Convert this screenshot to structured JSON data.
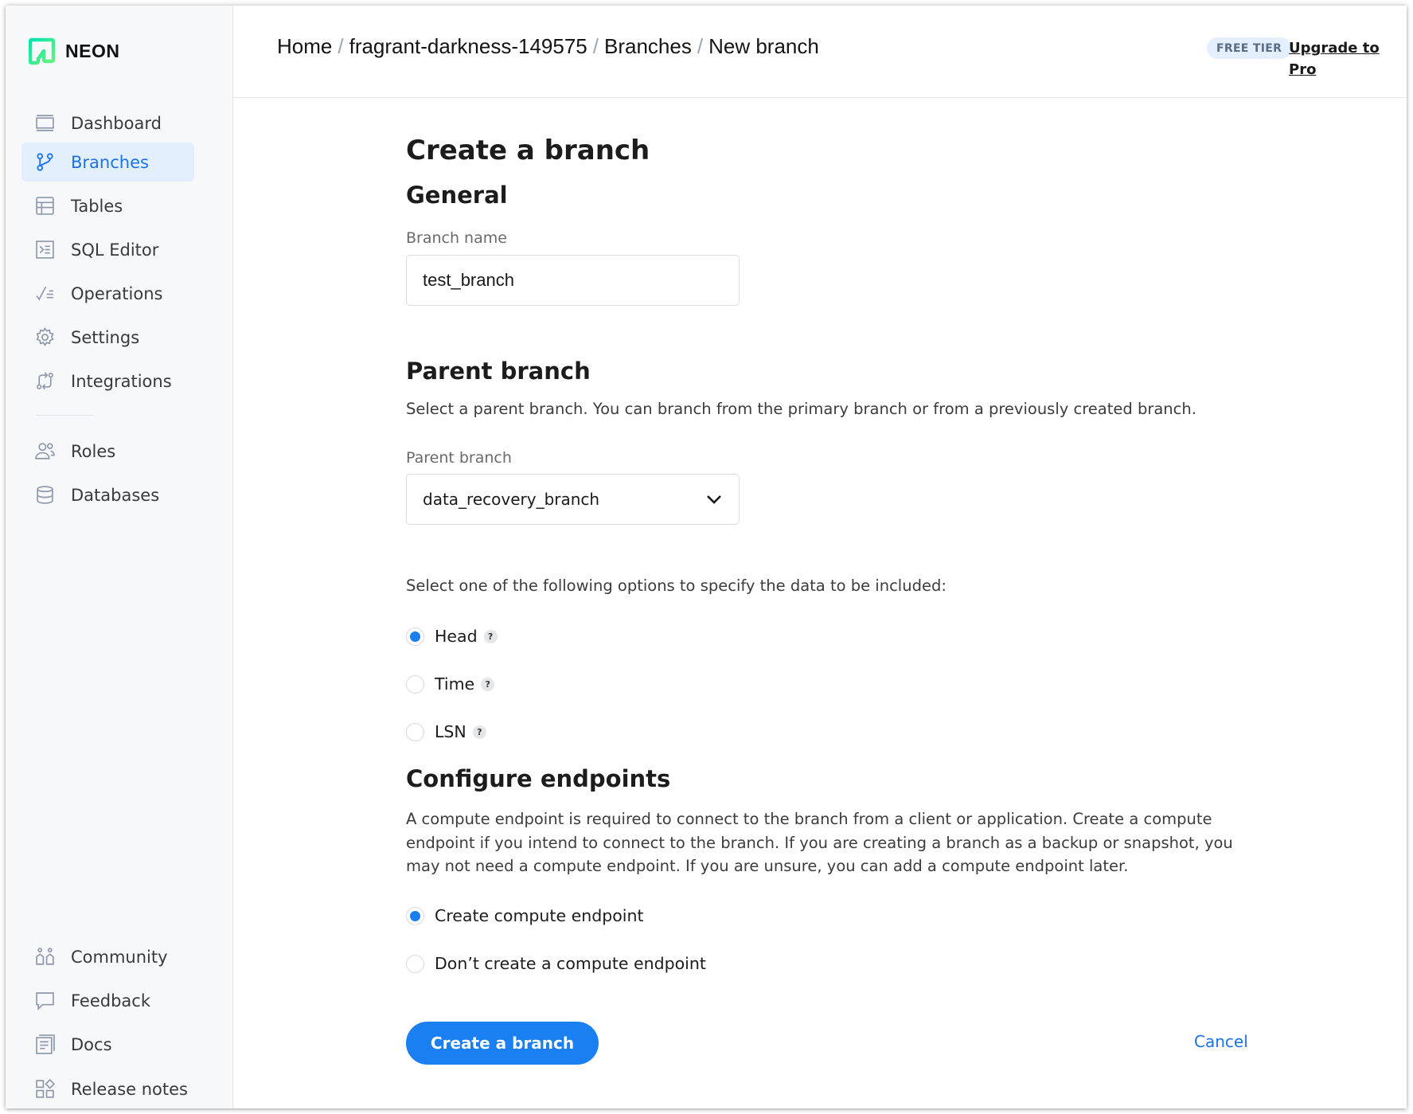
{
  "app": {
    "brand": "NEON",
    "brand_color": "#1a7ff0",
    "logo_colors": [
      "#00e599",
      "#2ee6a8",
      "#5ef28a"
    ]
  },
  "sidebar": {
    "items": [
      {
        "label": "Dashboard",
        "icon": "dashboard-icon",
        "active": false
      },
      {
        "label": "Branches",
        "icon": "branches-icon",
        "active": true
      },
      {
        "label": "Tables",
        "icon": "tables-icon",
        "active": false
      },
      {
        "label": "SQL Editor",
        "icon": "sql-editor-icon",
        "active": false
      },
      {
        "label": "Operations",
        "icon": "operations-icon",
        "active": false
      },
      {
        "label": "Settings",
        "icon": "gear-icon",
        "active": false
      },
      {
        "label": "Integrations",
        "icon": "integrations-icon",
        "active": false
      },
      {
        "label": "Roles",
        "icon": "roles-icon",
        "active": false
      },
      {
        "label": "Databases",
        "icon": "database-icon",
        "active": false
      }
    ],
    "footer_items": [
      {
        "label": "Community",
        "icon": "community-icon"
      },
      {
        "label": "Feedback",
        "icon": "feedback-icon"
      },
      {
        "label": "Docs",
        "icon": "docs-icon"
      },
      {
        "label": "Release notes",
        "icon": "release-notes-icon"
      }
    ]
  },
  "header": {
    "breadcrumb": [
      "Home",
      "fragrant-darkness-149575",
      "Branches",
      "New branch"
    ],
    "separator": "/",
    "tier_badge": "FREE TIER",
    "upgrade_link": "Upgrade to Pro"
  },
  "form": {
    "title": "Create a branch",
    "general": {
      "heading": "General",
      "branch_name_label": "Branch name",
      "branch_name_value": "test_branch"
    },
    "parent": {
      "heading": "Parent branch",
      "description": "Select a parent branch. You can branch from the primary branch or from a previously created branch.",
      "select_label": "Parent branch",
      "selected_value": "data_recovery_branch"
    },
    "data_options": {
      "prompt": "Select one of the following options to specify the data to be included:",
      "options": [
        {
          "label": "Head",
          "checked": true,
          "help": "?"
        },
        {
          "label": "Time",
          "checked": false,
          "help": "?"
        },
        {
          "label": "LSN",
          "checked": false,
          "help": "?"
        }
      ]
    },
    "endpoints": {
      "heading": "Configure endpoints",
      "description": "A compute endpoint is required to connect to the branch from a client or application. Create a compute endpoint if you intend to connect to the branch. If you are creating a branch as a backup or snapshot, you may not need a compute endpoint. If you are unsure, you can add a compute endpoint later.",
      "options": [
        {
          "label": "Create compute endpoint",
          "checked": true
        },
        {
          "label": "Don’t create a compute endpoint",
          "checked": false
        }
      ]
    },
    "submit_label": "Create a branch",
    "cancel_label": "Cancel"
  }
}
